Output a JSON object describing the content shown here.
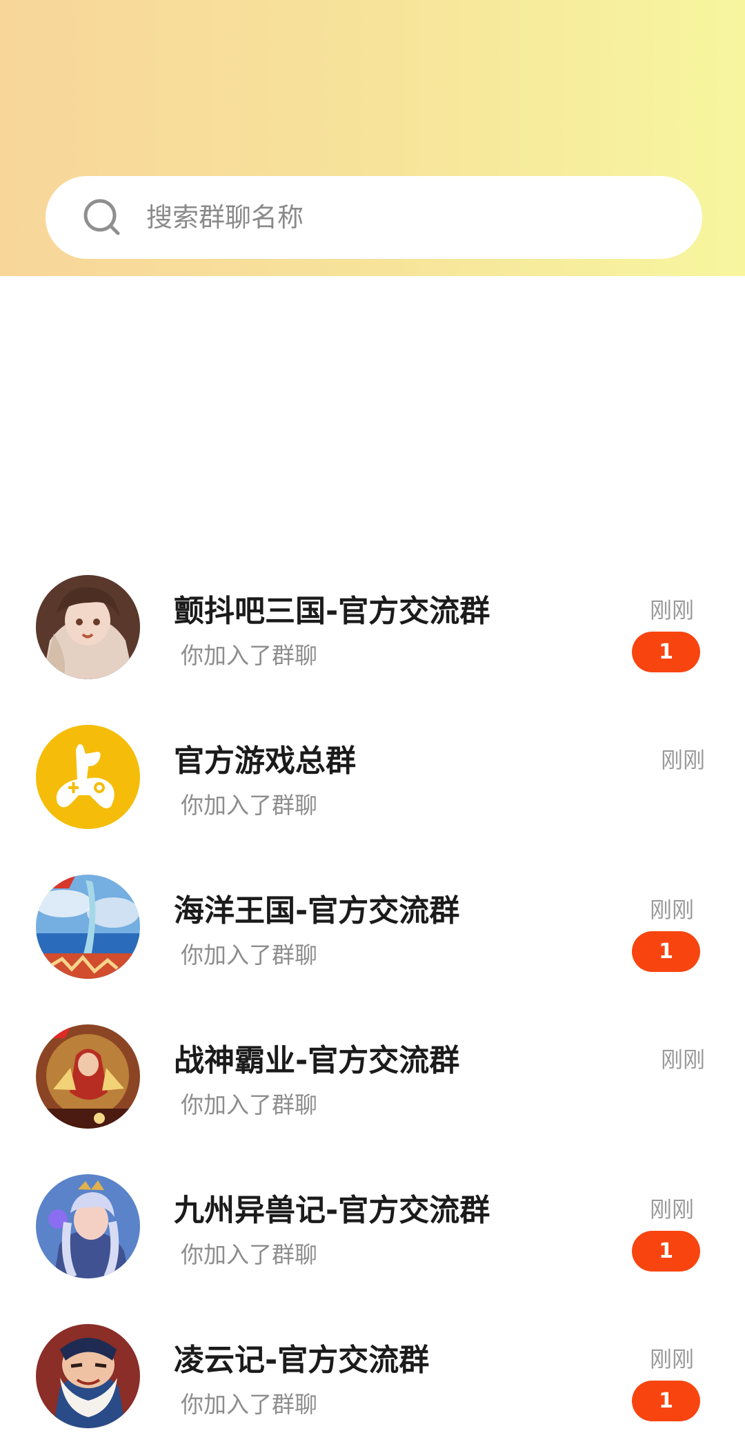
{
  "search": {
    "placeholder": "搜索群聊名称"
  },
  "groups": [
    {
      "title": "颤抖吧三国-官方交流群",
      "subtitle": "你加入了群聊",
      "time": "刚刚",
      "unread": "1",
      "avatar": "anime-girl-warrior-avatar"
    },
    {
      "title": "官方游戏总群",
      "subtitle": "你加入了群聊",
      "time": "刚刚",
      "unread": "",
      "avatar": "yellow-alpaca-gamepad-logo"
    },
    {
      "title": "海洋王国-官方交流群",
      "subtitle": "你加入了群聊",
      "time": "刚刚",
      "unread": "1",
      "avatar": "ocean-sky-game-avatar"
    },
    {
      "title": "战神霸业-官方交流群",
      "subtitle": "你加入了群聊",
      "time": "刚刚",
      "unread": "",
      "avatar": "war-god-game-avatar"
    },
    {
      "title": "九州异兽记-官方交流群",
      "subtitle": "你加入了群聊",
      "time": "刚刚",
      "unread": "1",
      "avatar": "fantasy-beast-girl-avatar"
    },
    {
      "title": "凌云记-官方交流群",
      "subtitle": "你加入了群聊",
      "time": "刚刚",
      "unread": "1",
      "avatar": "old-bearded-warrior-avatar"
    }
  ],
  "colors": {
    "header_start": "#f8d69a",
    "header_end": "#f7f69f",
    "badge": "#f84510",
    "logo_yellow": "#f5bd0a"
  }
}
